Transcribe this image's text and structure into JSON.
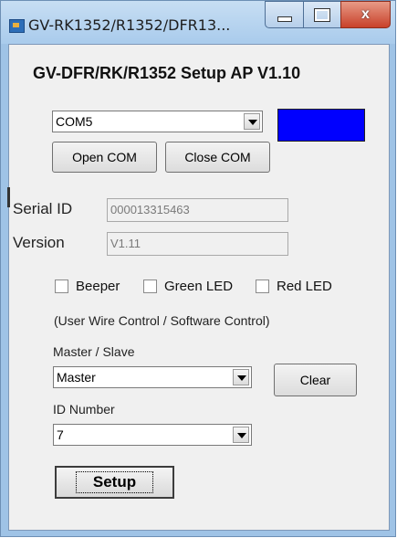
{
  "window": {
    "title": "GV-RK1352/R1352/DFR13...",
    "controls": {
      "minimize": "minimize",
      "maximize": "maximize",
      "close": "x"
    }
  },
  "heading": "GV-DFR/RK/R1352 Setup AP   V1.10",
  "com": {
    "port_value": "COM5",
    "status_color": "#0000ff",
    "open_label": "Open COM",
    "close_label": "Close COM"
  },
  "serial": {
    "label": "Serial ID",
    "value": "000013315463"
  },
  "version": {
    "label": "Version",
    "value": "V1.11"
  },
  "options": {
    "beeper": "Beeper",
    "green_led": "Green LED",
    "red_led": "Red LED",
    "note": "(User Wire Control / Software Control)"
  },
  "master_slave": {
    "label": "Master / Slave",
    "value": "Master"
  },
  "clear_label": "Clear",
  "id_number": {
    "label": "ID Number",
    "value": "7"
  },
  "setup_label": "Setup"
}
